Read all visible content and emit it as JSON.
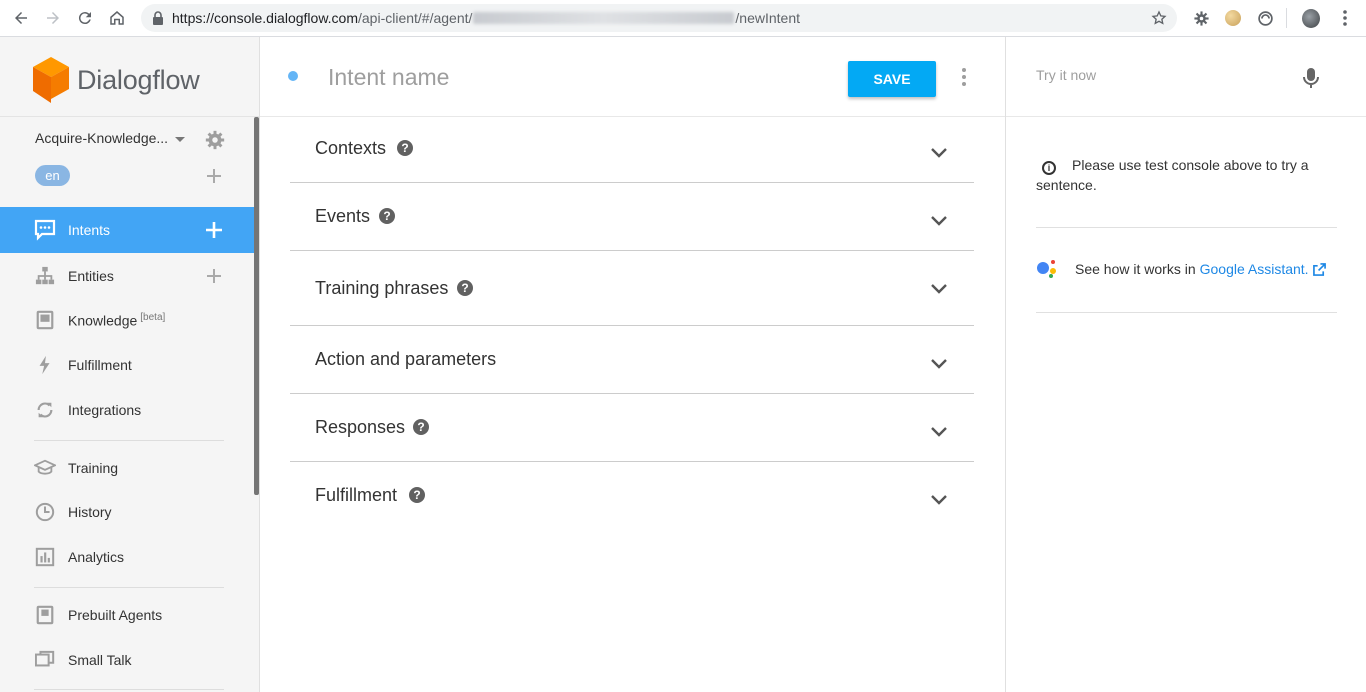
{
  "browser": {
    "url_main": "https://console.dialogflow.com",
    "url_path": "/api-client/#/agent/",
    "url_tail": "/newIntent"
  },
  "sidebar": {
    "logo_text": "Dialogflow",
    "agent_name": "Acquire-Knowledge...",
    "language": "en",
    "items": [
      {
        "label": "Intents",
        "icon": "intents-icon",
        "active": true
      },
      {
        "label": "Entities",
        "icon": "entities-icon"
      },
      {
        "label": "Knowledge",
        "icon": "knowledge-icon",
        "badge": "[beta]"
      },
      {
        "label": "Fulfillment",
        "icon": "fulfillment-icon"
      },
      {
        "label": "Integrations",
        "icon": "integrations-icon"
      },
      {
        "label": "Training",
        "icon": "training-icon"
      },
      {
        "label": "History",
        "icon": "history-icon"
      },
      {
        "label": "Analytics",
        "icon": "analytics-icon"
      },
      {
        "label": "Prebuilt Agents",
        "icon": "prebuilt-agents-icon"
      },
      {
        "label": "Small Talk",
        "icon": "small-talk-icon"
      }
    ]
  },
  "main": {
    "intent_placeholder": "Intent name",
    "save_label": "SAVE",
    "sections": [
      {
        "title": "Contexts",
        "help": "?"
      },
      {
        "title": "Events",
        "help": "?"
      },
      {
        "title": "Training phrases",
        "help": "?"
      },
      {
        "title": "Action and parameters"
      },
      {
        "title": "Responses",
        "help": "?"
      },
      {
        "title": "Fulfillment",
        "help": "?"
      }
    ]
  },
  "right_panel": {
    "try_placeholder": "Try it now",
    "info_text": "Please use test console above to try a sentence.",
    "ga_text": "See how it works in",
    "ga_link": "Google Assistant."
  },
  "colors": {
    "accent": "#42a5f5",
    "save_button": "#03a9f4",
    "link": "#1e88e5"
  }
}
